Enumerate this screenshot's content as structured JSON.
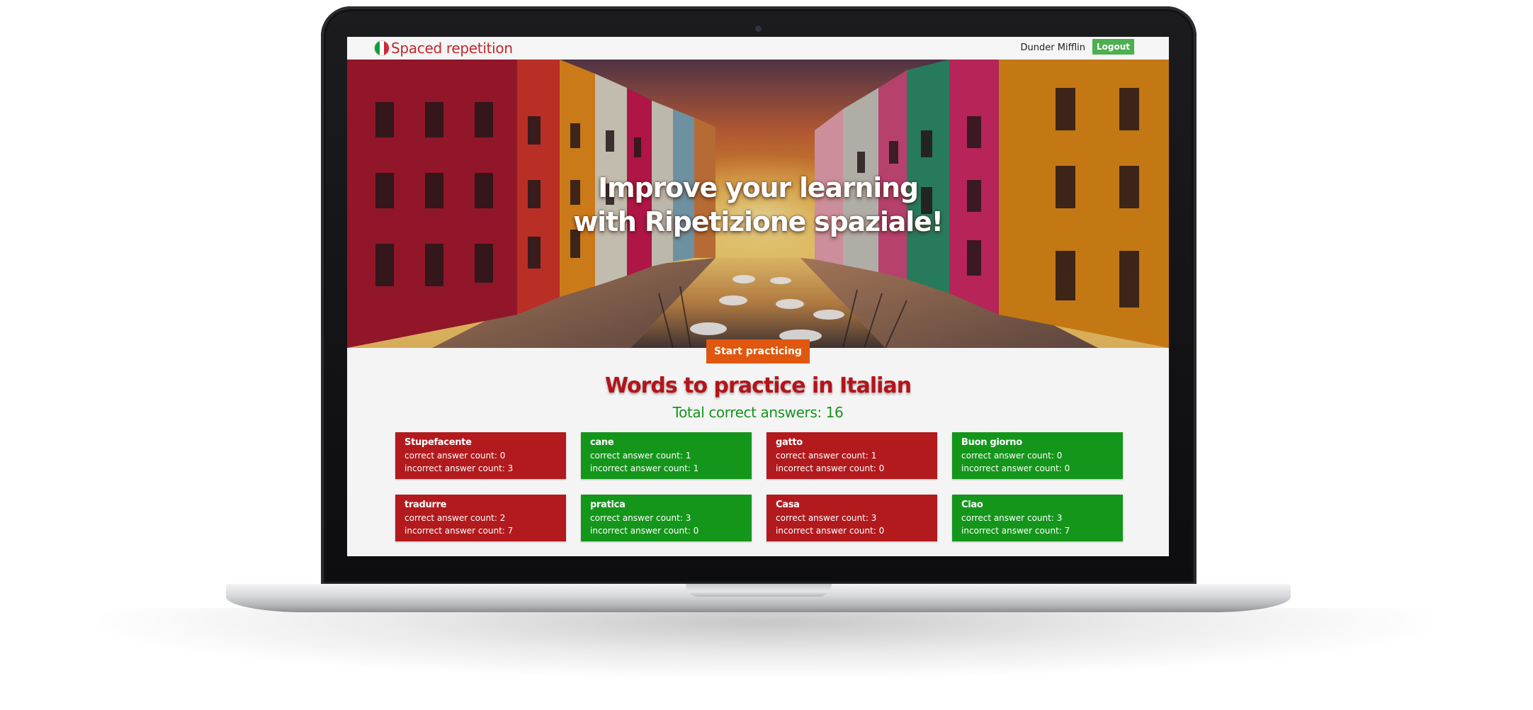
{
  "navbar": {
    "brand": "Spaced repetition",
    "user_name": "Dunder Mifflin",
    "logout_label": "Logout",
    "flag_colors": [
      "#0f9d3a",
      "#ffffff",
      "#ce2b37"
    ]
  },
  "hero": {
    "title_line1": "Improve your learning",
    "title_line2": "with Ripetizione spaziale!",
    "start_label": "Start practicing",
    "image": "venice-canal-colorful-houses-sunset"
  },
  "main": {
    "section_title": "Words to practice in Italian",
    "total_answers": "Total correct answers: 16"
  },
  "words": [
    {
      "name": "Stupefacente",
      "correct": "correct answer count: 0",
      "incorrect": "incorrect answer count: 3",
      "status": "red"
    },
    {
      "name": "cane",
      "correct": "correct answer count: 1",
      "incorrect": "incorrect answer count: 1",
      "status": "green"
    },
    {
      "name": "gatto",
      "correct": "correct answer count: 1",
      "incorrect": "incorrect answer count: 0",
      "status": "red"
    },
    {
      "name": "Buon giorno",
      "correct": "correct answer count: 0",
      "incorrect": "incorrect answer count: 0",
      "status": "green"
    },
    {
      "name": "tradurre",
      "correct": "correct answer count: 2",
      "incorrect": "incorrect answer count: 7",
      "status": "red"
    },
    {
      "name": "pratica",
      "correct": "correct answer count: 3",
      "incorrect": "incorrect answer count: 0",
      "status": "green"
    },
    {
      "name": "Casa",
      "correct": "correct answer count: 3",
      "incorrect": "incorrect answer count: 0",
      "status": "red"
    },
    {
      "name": "Ciao",
      "correct": "correct answer count: 3",
      "incorrect": "incorrect answer count: 7",
      "status": "green"
    }
  ],
  "colors": {
    "brand_red": "#c0282d",
    "card_red": "#b21a1d",
    "card_green": "#14961b",
    "start_orange": "#e0580f",
    "logout_green": "#4caf50"
  }
}
